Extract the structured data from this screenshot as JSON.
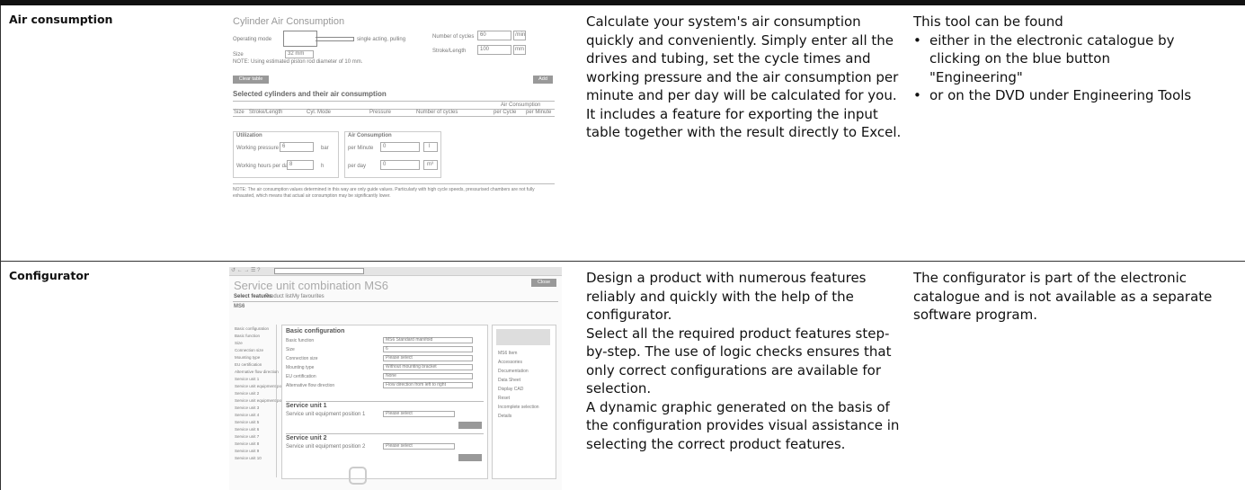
{
  "rows": [
    {
      "name": "Air consumption",
      "description": "Calculate your system's air consumption quickly and conveniently. Simply enter all the drives and tubing, set the cycle times and working pressure and the air consumption per minute and per day will be calculated for you. It includes a feature for exporting the input table together with the result directly to Excel.",
      "availability_intro": "This tool can be found",
      "availability_items": [
        "either in the electronic catalogue by clicking on the blue button \"Engineering\"",
        "or on the DVD under Engineering Tools"
      ],
      "screenshot": {
        "title": "Cylinder Air Consumption",
        "operating_mode_label": "Operating mode",
        "operating_mode_value": "single acting, pulling",
        "size_label": "Size",
        "size_value": "32 mm",
        "note_piston": "NOTE: Using estimated piston rod diameter of 10 mm.",
        "cycles_label": "Number of cycles",
        "cycles_value": "60",
        "cycles_unit": "/min",
        "stroke_label": "Stroke/Length",
        "stroke_value": "100",
        "stroke_unit": "mm",
        "clear_button": "Clear table",
        "add_button": "Add",
        "table_heading": "Selected cylinders and their air consumption",
        "table_group": "Air Consumption",
        "columns": [
          "Size",
          "Stroke/Length",
          "Cyl. Mode",
          "Pressure",
          "Number of cycles",
          "per Cycle",
          "per Minute"
        ],
        "utilization_title": "Utilization",
        "pressure_label": "Working pressure",
        "pressure_value": "6",
        "pressure_unit": "bar",
        "hours_label": "Working hours per day",
        "hours_value": "8",
        "hours_unit": "h",
        "air_title": "Air Consumption",
        "per_minute_label": "per Minute",
        "per_minute_value": "0",
        "per_minute_unit": "l",
        "per_day_label": "per day",
        "per_day_value": "0",
        "per_day_unit": "m³",
        "note_bottom": "NOTE: The air consumption values determined in this way are only guide values. Particularly with high cycle speeds, pressurised chambers are not fully exhausted, which means that actual air consumption may be significantly lower."
      }
    },
    {
      "name": "Configurator",
      "description_lines": [
        "Design a product with numerous features reliably and quickly with the help of the configurator.",
        "Select all the required product features step-by-step. The use of logic checks ensures that only correct configurations are available for selection.",
        "A dynamic graphic generated on the basis of the configuration provides visual assistance in selecting the correct product features."
      ],
      "availability": "The configurator is part of the electronic catalogue and is not available as a separate software program.",
      "screenshot": {
        "title": "Service unit combination MS6",
        "tabs": [
          "Select features",
          "Product list",
          "My favourites"
        ],
        "product_code": "MS6",
        "tree_items": [
          "Basic configuration",
          "Basic function",
          "Size",
          "Connection size",
          "Mounting type",
          "EU certification",
          "Alternative flow direction",
          "Service unit 1",
          "Service unit equipment position 1",
          "Service unit 2",
          "Service unit equipment position 2",
          "Service unit 3",
          "Service unit 4",
          "Service unit 5",
          "Service unit 6",
          "Service unit 7",
          "Service unit 8",
          "Service unit 9",
          "Service unit 10"
        ],
        "section_basic": "Basic configuration",
        "basic_fields": [
          {
            "label": "Basic function",
            "value": "MS6 Standard manifold"
          },
          {
            "label": "Size",
            "value": "6"
          },
          {
            "label": "Connection size",
            "value": "Please select"
          },
          {
            "label": "Mounting type",
            "value": "Without mounting bracket"
          },
          {
            "label": "EU certification",
            "value": "None"
          },
          {
            "label": "Alternative flow direction",
            "value": "Flow direction from left to right"
          }
        ],
        "section_unit1": "Service unit 1",
        "unit1_field": "Service unit equipment position 1",
        "section_unit2": "Service unit 2",
        "unit2_field": "Service unit equipment position 2",
        "select_placeholder": "Please select",
        "side_items": [
          "MS6 Item",
          "Accessories",
          "Documentation",
          "Data Sheet",
          "Display CAD",
          "Reset",
          "Incomplete selection",
          "Details"
        ],
        "close_button": "Close"
      }
    }
  ]
}
